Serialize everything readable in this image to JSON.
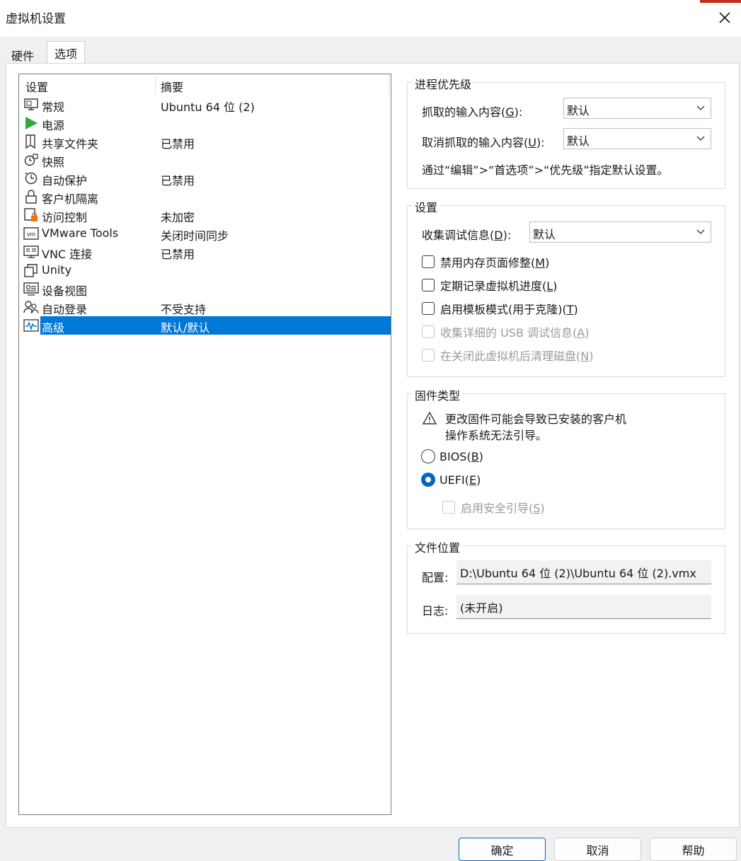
{
  "window": {
    "title": "虚拟机设置"
  },
  "tabs": [
    {
      "label": "硬件"
    },
    {
      "label": "选项"
    }
  ],
  "list": {
    "col_setting": "设置",
    "col_summary": "摘要",
    "items": [
      {
        "name": "常规",
        "summary": "Ubuntu 64 位 (2)",
        "icon": "monitor-icon"
      },
      {
        "name": "电源",
        "summary": "",
        "icon": "power-play-icon"
      },
      {
        "name": "共享文件夹",
        "summary": "已禁用",
        "icon": "shared-folder-icon"
      },
      {
        "name": "快照",
        "summary": "",
        "icon": "snapshot-icon"
      },
      {
        "name": "自动保护",
        "summary": "已禁用",
        "icon": "clock-icon"
      },
      {
        "name": "客户机隔离",
        "summary": "",
        "icon": "lock-icon"
      },
      {
        "name": "访问控制",
        "summary": "未加密",
        "icon": "access-control-icon"
      },
      {
        "name": "VMware Tools",
        "summary": "关闭时间同步",
        "icon": "vm-icon"
      },
      {
        "name": "VNC 连接",
        "summary": "已禁用",
        "icon": "vnc-icon"
      },
      {
        "name": "Unity",
        "summary": "",
        "icon": "unity-icon"
      },
      {
        "name": "设备视图",
        "summary": "",
        "icon": "device-view-icon"
      },
      {
        "name": "自动登录",
        "summary": "不受支持",
        "icon": "users-icon"
      },
      {
        "name": "高级",
        "summary": "默认/默认",
        "icon": "pulse-icon"
      }
    ]
  },
  "priority": {
    "title": "进程优先级",
    "grabbed_label": "抓取的输入内容(",
    "grabbed_key": "G",
    "grabbed_suffix": "):",
    "grabbed_value": "默认",
    "ungrabbed_label": "取消抓取的输入内容(",
    "ungrabbed_key": "U",
    "ungrabbed_suffix": "):",
    "ungrabbed_value": "默认",
    "note": "通过“编辑”>“首选项”>“优先级”指定默认设置。"
  },
  "settings": {
    "title": "设置",
    "debug_label": "收集调试信息(",
    "debug_key": "D",
    "debug_suffix": "):",
    "debug_value": "默认",
    "cb_memtrim": {
      "text": "禁用内存页面修整(",
      "key": "M",
      "suffix": ")"
    },
    "cb_progress": {
      "text": "定期记录虚拟机进度(",
      "key": "L",
      "suffix": ")"
    },
    "cb_template": {
      "text": "启用模板模式(用于克隆)(",
      "key": "T",
      "suffix": ")"
    },
    "cb_usb": {
      "text": "收集详细的 USB 调试信息(",
      "key": "A",
      "suffix": ")"
    },
    "cb_clean": {
      "text": "在关闭此虚拟机后清理磁盘(",
      "key": "N",
      "suffix": ")"
    }
  },
  "firmware": {
    "title": "固件类型",
    "warning_line1": "更改固件可能会导致已安装的客户机",
    "warning_line2": "操作系统无法引导。",
    "bios": {
      "text": "BIOS(",
      "key": "B",
      "suffix": ")"
    },
    "uefi": {
      "text": "UEFI(",
      "key": "E",
      "suffix": ")"
    },
    "secure": {
      "text": "启用安全引导(",
      "key": "S",
      "suffix": ")"
    }
  },
  "file": {
    "title": "文件位置",
    "config_label": "配置:",
    "config_value": "D:\\Ubuntu 64 位 (2)\\Ubuntu 64 位 (2).vmx",
    "log_label": "日志:",
    "log_value": "(未开启)"
  },
  "buttons": {
    "ok": "确定",
    "cancel": "取消",
    "help": "帮助"
  },
  "colors": {
    "selection": "#0078d7",
    "radio_checked": "#0067c0",
    "close_accent": "#c42b1c"
  }
}
